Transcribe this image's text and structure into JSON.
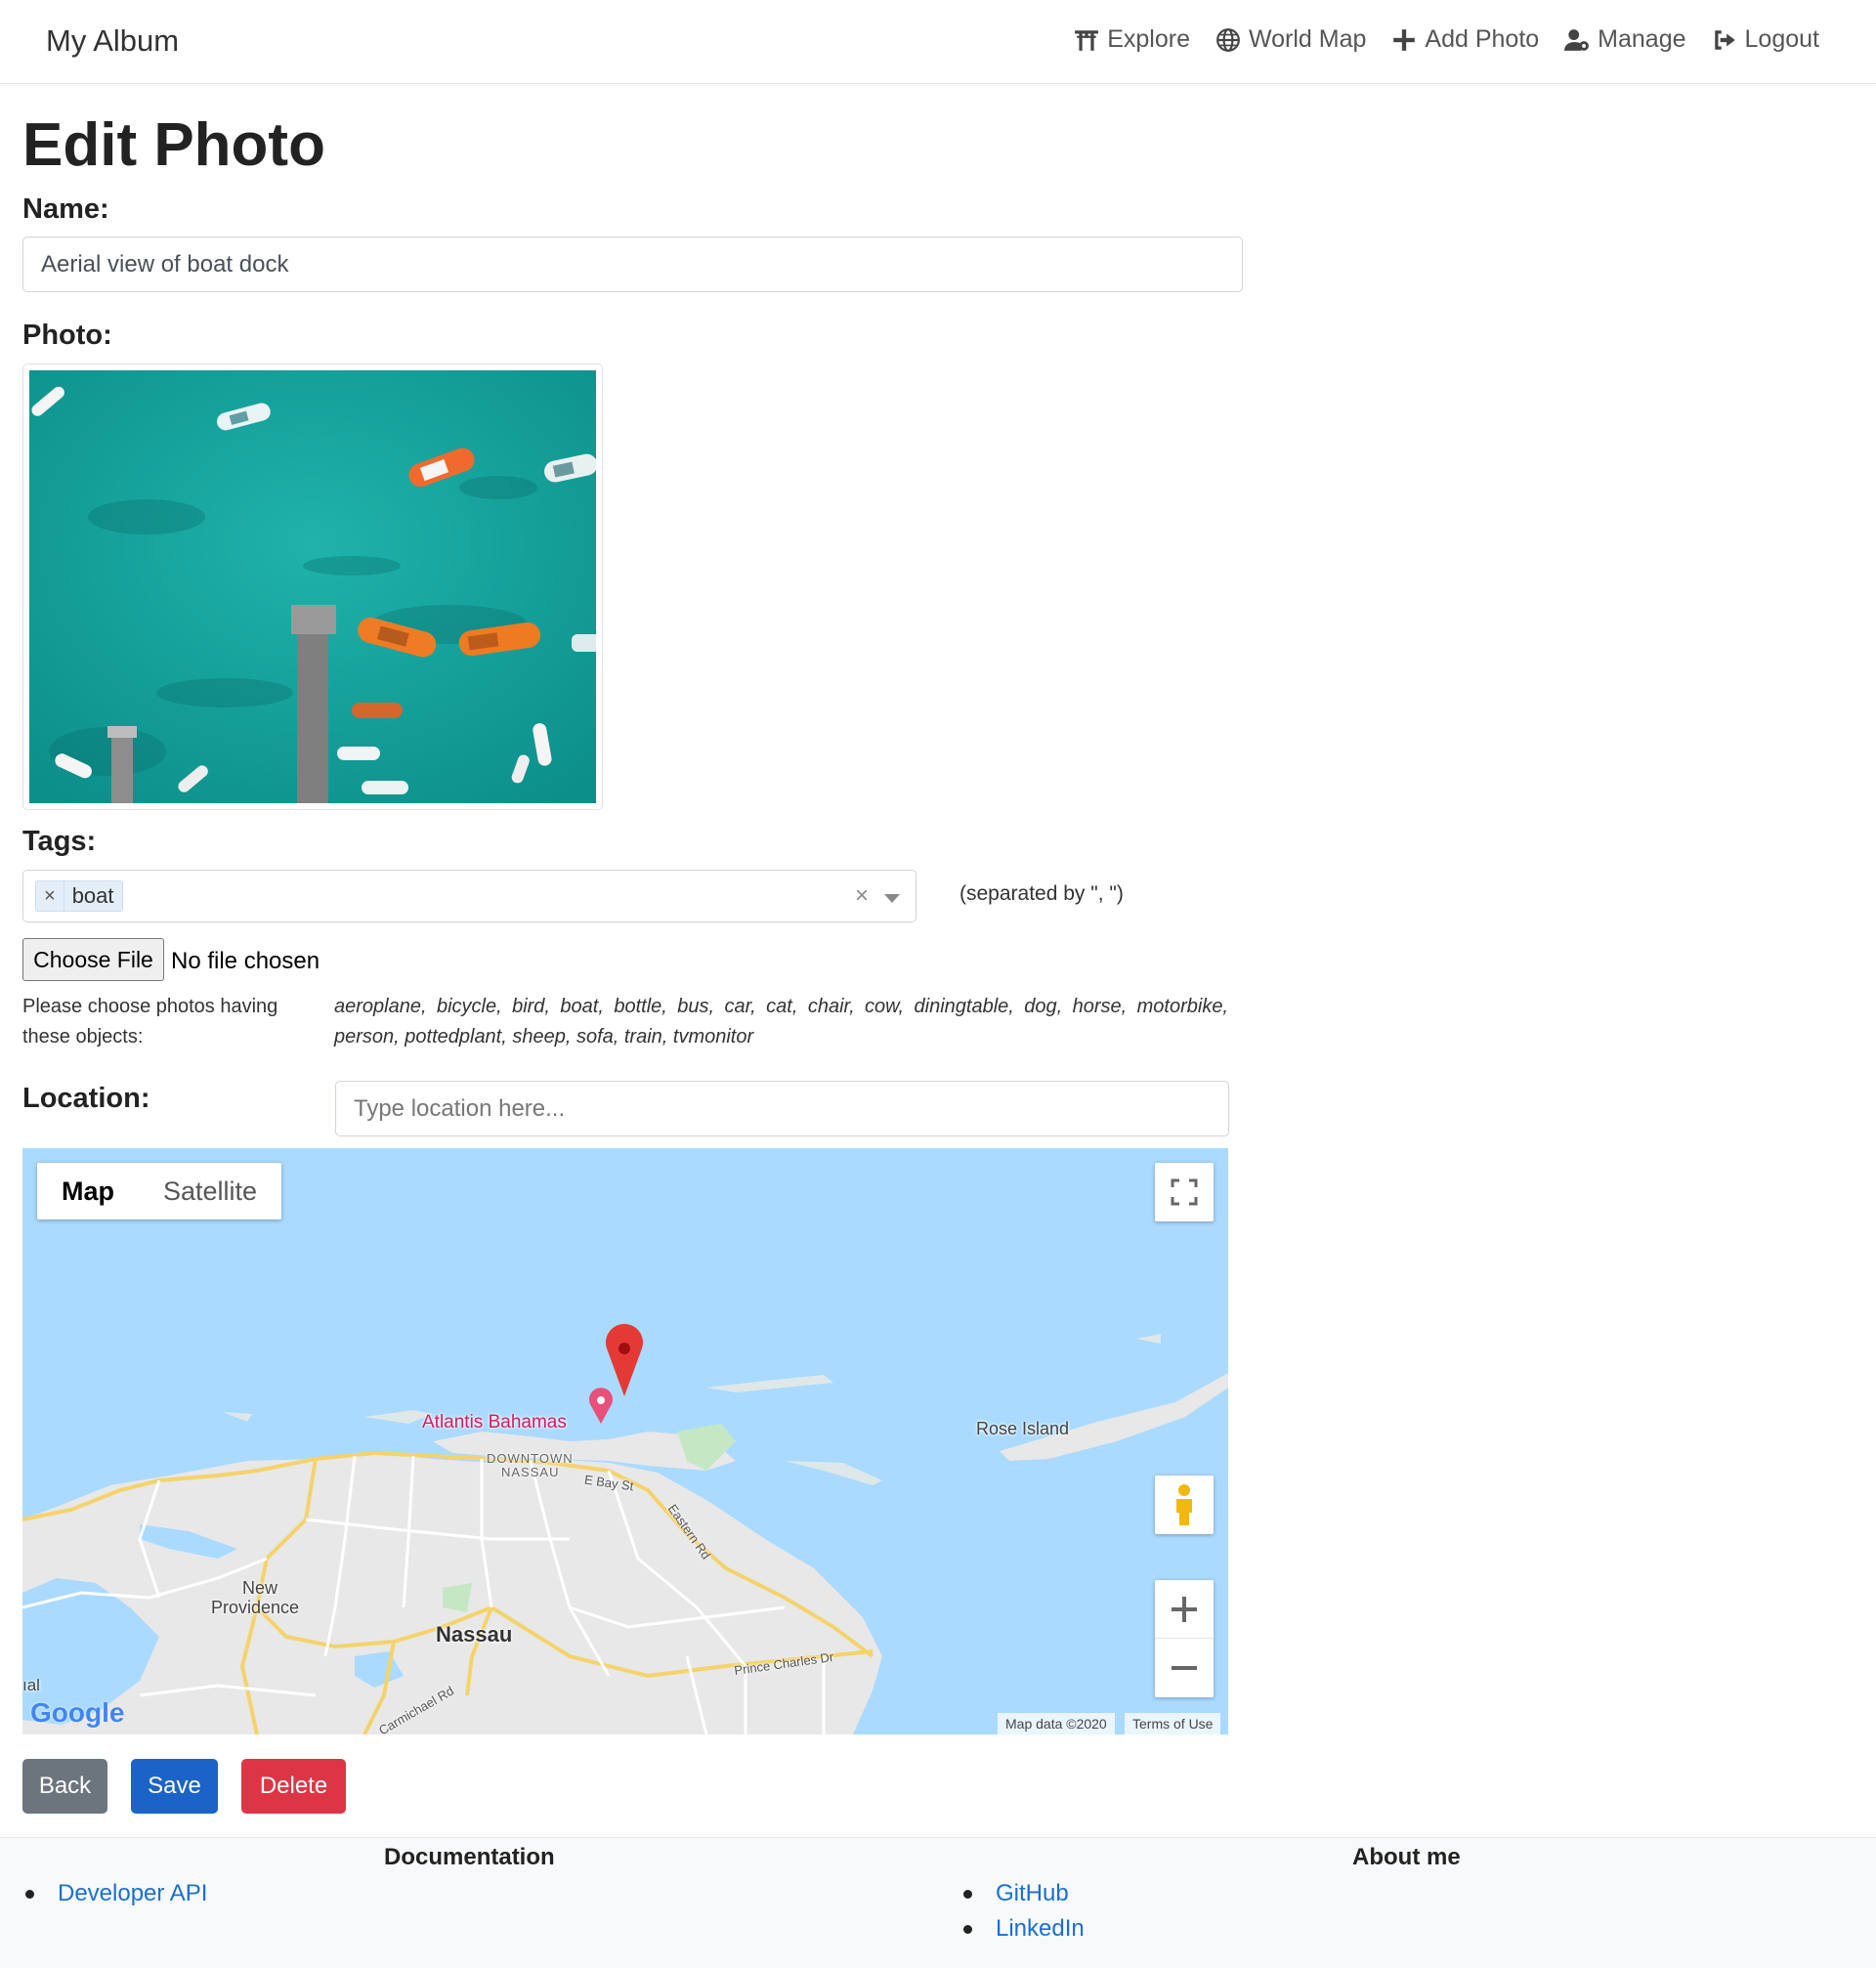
{
  "navbar": {
    "brand": "My Album",
    "items": [
      {
        "label": "Explore",
        "icon": "torii-gate-icon"
      },
      {
        "label": "World Map",
        "icon": "globe-icon"
      },
      {
        "label": "Add Photo",
        "icon": "plus-icon"
      },
      {
        "label": "Manage",
        "icon": "user-cog-icon"
      },
      {
        "label": "Logout",
        "icon": "sign-out-icon"
      }
    ]
  },
  "page": {
    "title": "Edit Photo"
  },
  "form": {
    "name_label": "Name:",
    "name_value": "Aerial view of boat dock",
    "photo_label": "Photo:",
    "tags_label": "Tags:",
    "tags": [
      "boat"
    ],
    "tag_remove_glyph": "×",
    "tags_clear_glyph": "×",
    "tags_hint": "(separated by \", \")",
    "file_button": "Choose File",
    "file_status": "No file chosen",
    "objects_hint": "Please choose photos having these objects:",
    "objects_list": "aeroplane, bicycle, bird, boat, bottle, bus, car, cat, chair, cow, diningtable, dog, horse, motorbike, person, pottedplant, sheep, sofa, train, tvmonitor",
    "location_label": "Location:",
    "location_placeholder": "Type location here..."
  },
  "map": {
    "types": [
      "Map",
      "Satellite"
    ],
    "active_type": "Map",
    "labels": {
      "atlantis": "Atlantis Bahamas",
      "rose_island": "Rose Island",
      "downtown": "DOWNTOWN",
      "nassau_small": "NASSAU",
      "e_bay_st": "E Bay St",
      "eastern_rd": "Eastern Rd",
      "new": "New",
      "providence": "Providence",
      "nassau": "Nassau",
      "prince_charles": "Prince Charles Dr",
      "carmichael": "Carmichael Rd",
      "edge_fragment": "ıal"
    },
    "logo": "Google",
    "map_data": "Map data ©2020",
    "terms": "Terms of Use",
    "colors": {
      "water": "#aadaff",
      "land": "#e8e8e8",
      "road": "#f5d36b",
      "marker": "#e53935",
      "poi": "#e84f7a"
    }
  },
  "actions": {
    "back": "Back",
    "save": "Save",
    "delete": "Delete",
    "colors": {
      "back": "#6c757d",
      "save": "#1b63c6",
      "delete": "#dc3545"
    }
  },
  "footer": {
    "documentation_heading": "Documentation",
    "documentation_links": [
      "Developer API"
    ],
    "about_heading": "About me",
    "about_links": [
      "GitHub",
      "LinkedIn"
    ]
  }
}
